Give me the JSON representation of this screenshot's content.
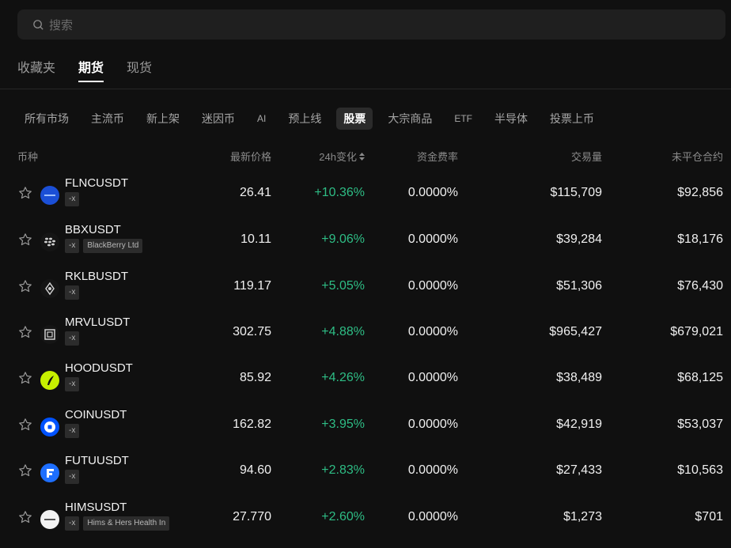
{
  "search": {
    "placeholder": "搜索"
  },
  "main_tabs": [
    "收藏夹",
    "期货",
    "现货"
  ],
  "filters": [
    "所有市场",
    "主流币",
    "新上架",
    "迷因币",
    "AI",
    "预上线",
    "股票",
    "大宗商品",
    "ETF",
    "半导体",
    "投票上币"
  ],
  "columns": {
    "coin": "币种",
    "price": "最新价格",
    "change": "24h变化",
    "funding": "资金费率",
    "volume": "交易量",
    "open_interest": "未平仓合约"
  },
  "colors": {
    "accent_green": "#2ebd85",
    "active_tab": "#ffffff"
  },
  "rows": [
    {
      "symbol": "FLNCUSDT",
      "tags": [
        "-x"
      ],
      "price": "26.41",
      "change": "+10.36%",
      "funding": "0.0000%",
      "volume": "$115,709",
      "open_interest": "$92,856",
      "logo": "fluence-logo"
    },
    {
      "symbol": "BBXUSDT",
      "tags": [
        "-x",
        "BlackBerry Ltd"
      ],
      "price": "10.11",
      "change": "+9.06%",
      "funding": "0.0000%",
      "volume": "$39,284",
      "open_interest": "$18,176",
      "logo": "blackberry-logo"
    },
    {
      "symbol": "RKLBUSDT",
      "tags": [
        "-x"
      ],
      "price": "119.17",
      "change": "+5.05%",
      "funding": "0.0000%",
      "volume": "$51,306",
      "open_interest": "$76,430",
      "logo": "rocketlab-logo"
    },
    {
      "symbol": "MRVLUSDT",
      "tags": [
        "-x"
      ],
      "price": "302.75",
      "change": "+4.88%",
      "funding": "0.0000%",
      "volume": "$965,427",
      "open_interest": "$679,021",
      "logo": "marvell-logo"
    },
    {
      "symbol": "HOODUSDT",
      "tags": [
        "-x"
      ],
      "price": "85.92",
      "change": "+4.26%",
      "funding": "0.0000%",
      "volume": "$38,489",
      "open_interest": "$68,125",
      "logo": "robinhood-logo"
    },
    {
      "symbol": "COINUSDT",
      "tags": [
        "-x"
      ],
      "price": "162.82",
      "change": "+3.95%",
      "funding": "0.0000%",
      "volume": "$42,919",
      "open_interest": "$53,037",
      "logo": "coinbase-logo"
    },
    {
      "symbol": "FUTUUSDT",
      "tags": [
        "-x"
      ],
      "price": "94.60",
      "change": "+2.83%",
      "funding": "0.0000%",
      "volume": "$27,433",
      "open_interest": "$10,563",
      "logo": "futu-logo"
    },
    {
      "symbol": "HIMSUSDT",
      "tags": [
        "-x",
        "Hims & Hers Health In"
      ],
      "price": "27.770",
      "change": "+2.60%",
      "funding": "0.0000%",
      "volume": "$1,273",
      "open_interest": "$701",
      "logo": "hims-logo"
    }
  ]
}
